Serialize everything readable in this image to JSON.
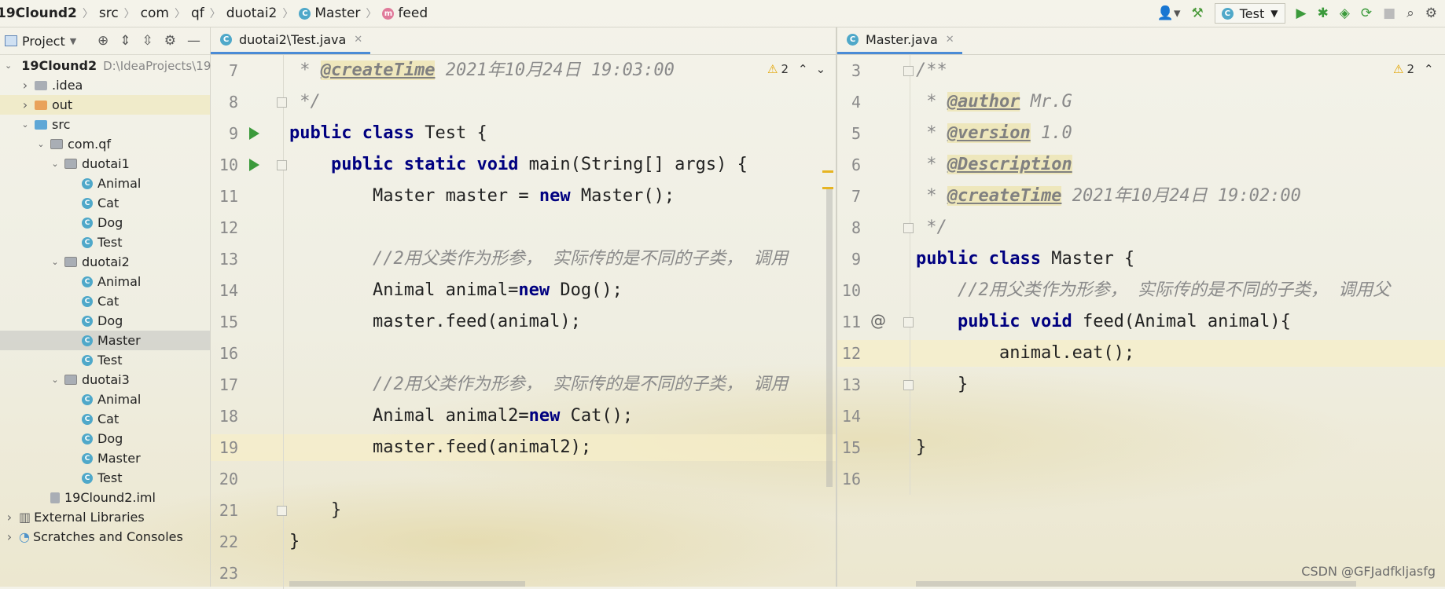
{
  "breadcrumb": [
    "19Clound2",
    "src",
    "com",
    "qf",
    "duotai2",
    "Master",
    "feed"
  ],
  "toolbar": {
    "run_config": "Test",
    "user_icon": "user-icon",
    "build_icon": "hammer-icon"
  },
  "project_panel": {
    "title": "Project",
    "tree": [
      {
        "label": "19Clound2",
        "path": "D:\\IdeaProjects\\19",
        "icon": "module-folder",
        "depth": 0,
        "expand": "open"
      },
      {
        "label": ".idea",
        "icon": "folder",
        "depth": 1,
        "expand": "closed"
      },
      {
        "label": "out",
        "icon": "folder-orange",
        "depth": 1,
        "expand": "closed"
      },
      {
        "label": "src",
        "icon": "folder-blue",
        "depth": 1,
        "expand": "open"
      },
      {
        "label": "com.qf",
        "icon": "package",
        "depth": 2,
        "expand": "open"
      },
      {
        "label": "duotai1",
        "icon": "package",
        "depth": 3,
        "expand": "open"
      },
      {
        "label": "Animal",
        "icon": "class",
        "depth": 4
      },
      {
        "label": "Cat",
        "icon": "class",
        "depth": 4
      },
      {
        "label": "Dog",
        "icon": "class",
        "depth": 4
      },
      {
        "label": "Test",
        "icon": "class",
        "depth": 4
      },
      {
        "label": "duotai2",
        "icon": "package",
        "depth": 3,
        "expand": "open"
      },
      {
        "label": "Animal",
        "icon": "class",
        "depth": 4
      },
      {
        "label": "Cat",
        "icon": "class",
        "depth": 4
      },
      {
        "label": "Dog",
        "icon": "class",
        "depth": 4
      },
      {
        "label": "Master",
        "icon": "class",
        "depth": 4,
        "selected": true
      },
      {
        "label": "Test",
        "icon": "class",
        "depth": 4
      },
      {
        "label": "duotai3",
        "icon": "package",
        "depth": 3,
        "expand": "open"
      },
      {
        "label": "Animal",
        "icon": "class",
        "depth": 4
      },
      {
        "label": "Cat",
        "icon": "class",
        "depth": 4
      },
      {
        "label": "Dog",
        "icon": "class",
        "depth": 4
      },
      {
        "label": "Master",
        "icon": "class",
        "depth": 4
      },
      {
        "label": "Test",
        "icon": "class",
        "depth": 4
      },
      {
        "label": "19Clound2.iml",
        "icon": "iml-file",
        "depth": 2
      },
      {
        "label": "External Libraries",
        "icon": "libraries",
        "depth": 0,
        "expand": "closed"
      },
      {
        "label": "Scratches and Consoles",
        "icon": "scratches",
        "depth": 0,
        "expand": "closed"
      }
    ]
  },
  "left_editor": {
    "tab": "duotai2\\Test.java",
    "warnings": "2",
    "lines": [
      {
        "n": "7",
        "parts": [
          {
            "t": " * ",
            "c": "cm"
          },
          {
            "t": "@createTime",
            "c": "tag"
          },
          {
            "t": " 2021年10月24日 19:03:00",
            "c": "cm"
          }
        ]
      },
      {
        "n": "8",
        "parts": [
          {
            "t": " */",
            "c": "cm"
          }
        ]
      },
      {
        "n": "9",
        "parts": [
          {
            "t": "public",
            "c": "kw"
          },
          {
            "t": " "
          },
          {
            "t": "class",
            "c": "kw"
          },
          {
            "t": " Test {"
          }
        ]
      },
      {
        "n": "10",
        "parts": [
          {
            "t": "    "
          },
          {
            "t": "public",
            "c": "kw"
          },
          {
            "t": " "
          },
          {
            "t": "static",
            "c": "kw"
          },
          {
            "t": " "
          },
          {
            "t": "void",
            "c": "kw"
          },
          {
            "t": " main(String[] args) {"
          }
        ]
      },
      {
        "n": "11",
        "parts": [
          {
            "t": "        Master master = "
          },
          {
            "t": "new",
            "c": "kw"
          },
          {
            "t": " Master();"
          }
        ]
      },
      {
        "n": "12",
        "parts": []
      },
      {
        "n": "13",
        "parts": [
          {
            "t": "        //2用父类作为形参， 实际传的是不同的子类， 调用",
            "c": "cm"
          }
        ]
      },
      {
        "n": "14",
        "parts": [
          {
            "t": "        Animal animal="
          },
          {
            "t": "new",
            "c": "kw"
          },
          {
            "t": " Dog();"
          }
        ]
      },
      {
        "n": "15",
        "parts": [
          {
            "t": "        master.feed(animal);"
          }
        ]
      },
      {
        "n": "16",
        "parts": []
      },
      {
        "n": "17",
        "parts": [
          {
            "t": "        //2用父类作为形参， 实际传的是不同的子类， 调用",
            "c": "cm"
          }
        ]
      },
      {
        "n": "18",
        "parts": [
          {
            "t": "        Animal animal2="
          },
          {
            "t": "new",
            "c": "kw"
          },
          {
            "t": " Cat();"
          }
        ]
      },
      {
        "n": "19",
        "parts": [
          {
            "t": "        master.feed(animal2);"
          }
        ]
      },
      {
        "n": "20",
        "parts": []
      },
      {
        "n": "21",
        "parts": [
          {
            "t": "    }"
          }
        ]
      },
      {
        "n": "22",
        "parts": [
          {
            "t": "}"
          }
        ]
      },
      {
        "n": "23",
        "parts": []
      }
    ]
  },
  "right_editor": {
    "tab": "Master.java",
    "warnings": "2",
    "lines": [
      {
        "n": "3",
        "parts": [
          {
            "t": "/**",
            "c": "cm"
          }
        ]
      },
      {
        "n": "4",
        "parts": [
          {
            "t": " * ",
            "c": "cm"
          },
          {
            "t": "@author",
            "c": "tag"
          },
          {
            "t": " Mr.G",
            "c": "cm"
          }
        ]
      },
      {
        "n": "5",
        "parts": [
          {
            "t": " * ",
            "c": "cm"
          },
          {
            "t": "@version",
            "c": "tag"
          },
          {
            "t": " 1.0",
            "c": "cm"
          }
        ]
      },
      {
        "n": "6",
        "parts": [
          {
            "t": " * ",
            "c": "cm"
          },
          {
            "t": "@Description",
            "c": "tag"
          }
        ]
      },
      {
        "n": "7",
        "parts": [
          {
            "t": " * ",
            "c": "cm"
          },
          {
            "t": "@createTime",
            "c": "tag"
          },
          {
            "t": " 2021年10月24日 19:02:00",
            "c": "cm"
          }
        ]
      },
      {
        "n": "8",
        "parts": [
          {
            "t": " */",
            "c": "cm"
          }
        ]
      },
      {
        "n": "9",
        "parts": [
          {
            "t": "public",
            "c": "kw"
          },
          {
            "t": " "
          },
          {
            "t": "class",
            "c": "kw"
          },
          {
            "t": " Master {"
          }
        ]
      },
      {
        "n": "10",
        "parts": [
          {
            "t": "    //2用父类作为形参， 实际传的是不同的子类， 调用父",
            "c": "cm"
          }
        ]
      },
      {
        "n": "11",
        "parts": [
          {
            "t": "    "
          },
          {
            "t": "public",
            "c": "kw"
          },
          {
            "t": " "
          },
          {
            "t": "void",
            "c": "kw"
          },
          {
            "t": " feed(Animal animal){"
          }
        ]
      },
      {
        "n": "12",
        "parts": [
          {
            "t": "        animal.eat();"
          }
        ]
      },
      {
        "n": "13",
        "parts": [
          {
            "t": "    }"
          }
        ]
      },
      {
        "n": "14",
        "parts": []
      },
      {
        "n": "15",
        "parts": [
          {
            "t": "}"
          }
        ]
      },
      {
        "n": "16",
        "parts": []
      }
    ]
  },
  "watermark": "CSDN @GFJadfkljasfg"
}
